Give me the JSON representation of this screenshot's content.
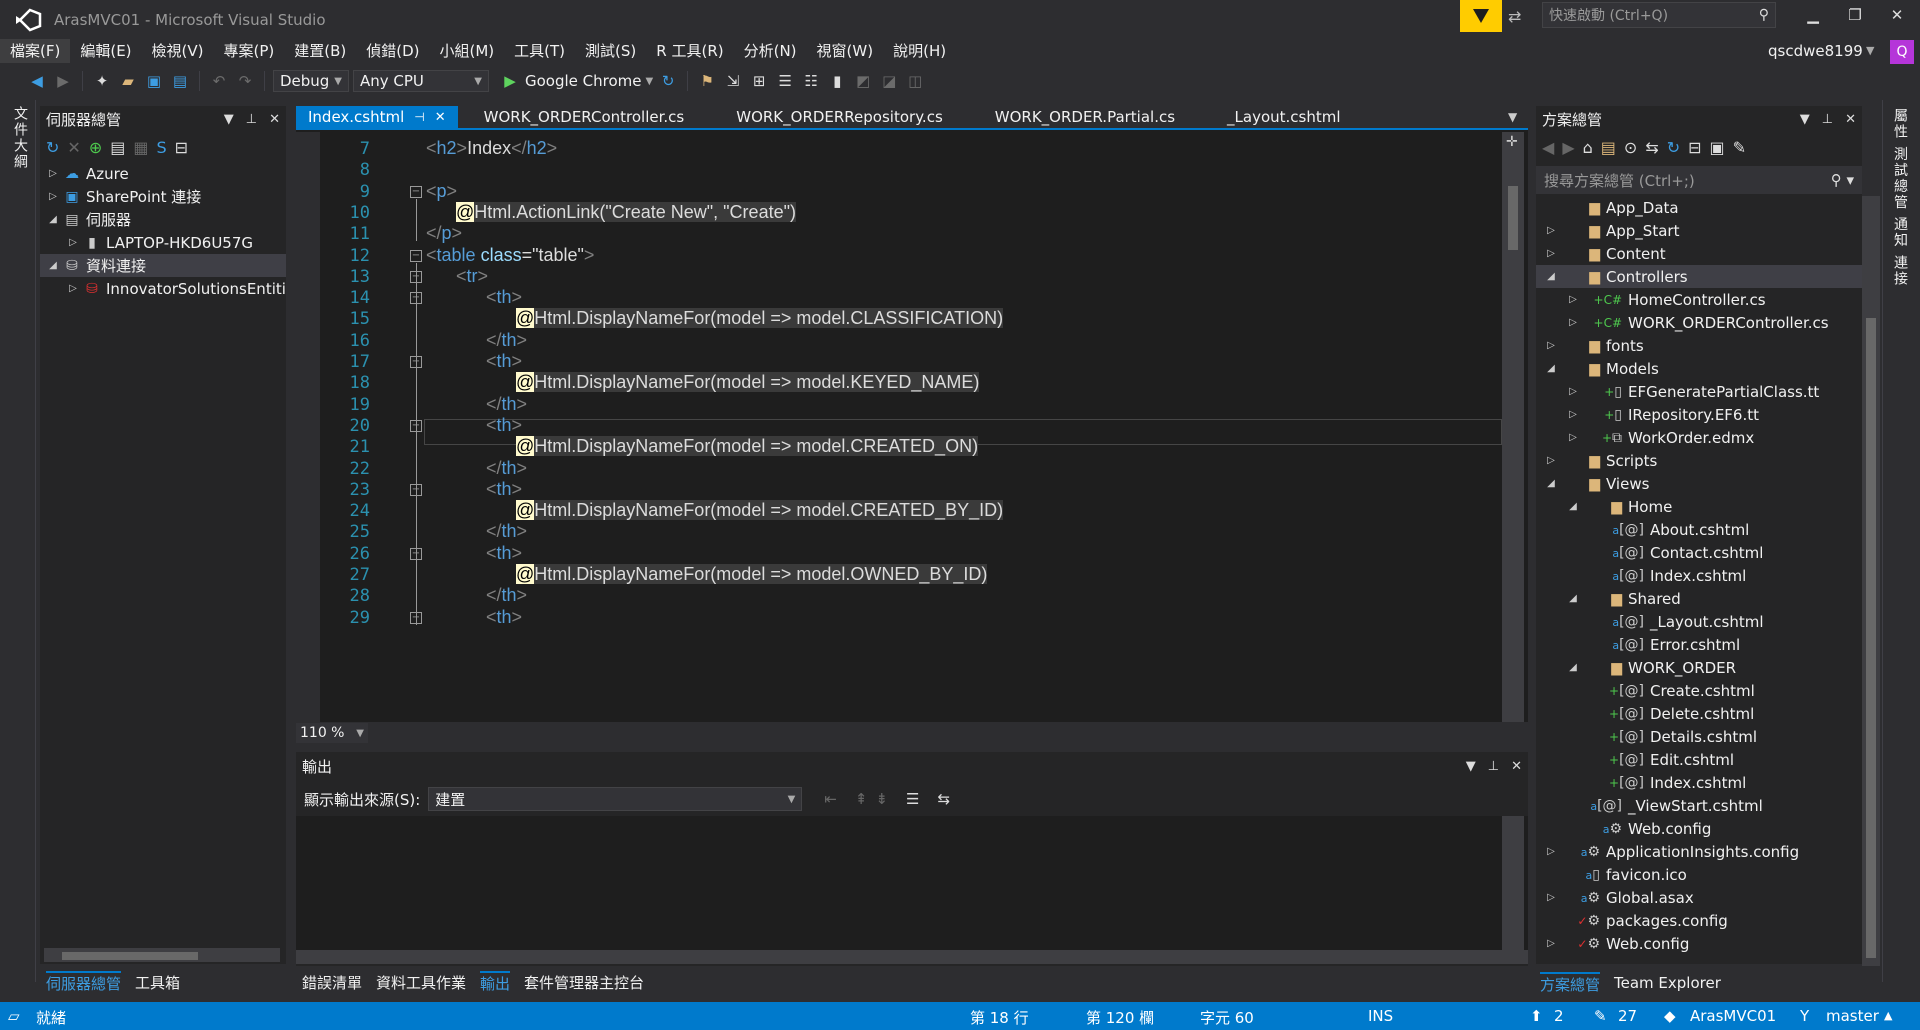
{
  "title": "ArasMVC01 - Microsoft Visual Studio",
  "quick_launch": {
    "placeholder": "快速啟動 (Ctrl+Q)"
  },
  "menu": [
    "檔案(F)",
    "編輯(E)",
    "檢視(V)",
    "專案(P)",
    "建置(B)",
    "偵錯(D)",
    "小組(M)",
    "工具(T)",
    "測試(S)",
    "R 工具(R)",
    "分析(N)",
    "視窗(W)",
    "說明(H)"
  ],
  "user": "qscdwe8199",
  "avatar_letter": "Q",
  "toolbar": {
    "config": "Debug",
    "platform": "Any CPU",
    "run_target": "Google Chrome"
  },
  "left_strip": "文件大綱",
  "server_explorer": {
    "title": "伺服器總管",
    "items": [
      {
        "label": "Azure",
        "indent": 0,
        "expander": "right",
        "icon": "cloud-icon"
      },
      {
        "label": "SharePoint 連接",
        "indent": 0,
        "expander": "right",
        "icon": "sharepoint-icon"
      },
      {
        "label": "伺服器",
        "indent": 0,
        "expander": "down",
        "icon": "server-icon"
      },
      {
        "label": "LAPTOP-HKD6U57G",
        "indent": 1,
        "expander": "right",
        "icon": "computer-icon"
      },
      {
        "label": "資料連接",
        "indent": 0,
        "expander": "down",
        "icon": "data-connection-icon",
        "selected": true
      },
      {
        "label": "InnovatorSolutionsEntities",
        "indent": 1,
        "expander": "right",
        "icon": "database-error-icon"
      }
    ],
    "bottom_tabs": [
      "伺服器總管",
      "工具箱"
    ]
  },
  "editor": {
    "tabs": [
      {
        "label": "Index.cshtml",
        "active": true
      },
      {
        "label": "WORK_ORDERController.cs"
      },
      {
        "label": "WORK_ORDERRepository.cs"
      },
      {
        "label": "WORK_ORDER.Partial.cs"
      },
      {
        "label": "_Layout.cshtml"
      }
    ],
    "zoom": "110 %",
    "lines": [
      {
        "n": "7",
        "indent": 0,
        "parts": [
          [
            "tag",
            "<"
          ],
          [
            "tname",
            "h2"
          ],
          [
            "tag",
            ">"
          ],
          [
            "txt",
            "Index"
          ],
          [
            "tag",
            "</"
          ],
          [
            "tname",
            "h2"
          ],
          [
            "tag",
            ">"
          ]
        ]
      },
      {
        "n": "8",
        "indent": 0,
        "parts": []
      },
      {
        "n": "9",
        "indent": 0,
        "fold": true,
        "parts": [
          [
            "tag",
            "<"
          ],
          [
            "tname",
            "p"
          ],
          [
            "tag",
            ">"
          ]
        ]
      },
      {
        "n": "10",
        "indent": 1,
        "parts": [
          [
            "razor",
            "@"
          ],
          [
            "rzcode",
            "Html.ActionLink("
          ],
          [
            "rzstr",
            "\"Create New\""
          ],
          [
            "rzcode",
            ", "
          ],
          [
            "rzstr",
            "\"Create\""
          ],
          [
            "rzcode",
            ")"
          ]
        ]
      },
      {
        "n": "11",
        "indent": 0,
        "parts": [
          [
            "tag",
            "</"
          ],
          [
            "tname",
            "p"
          ],
          [
            "tag",
            ">"
          ]
        ]
      },
      {
        "n": "12",
        "indent": 0,
        "fold": true,
        "parts": [
          [
            "tag",
            "<"
          ],
          [
            "tname",
            "table"
          ],
          [
            "txt",
            " "
          ],
          [
            "attr",
            "class"
          ],
          [
            "txt",
            "=\"table\""
          ],
          [
            "tag",
            ">"
          ]
        ]
      },
      {
        "n": "13",
        "indent": 1,
        "fold": true,
        "parts": [
          [
            "tag",
            "<"
          ],
          [
            "tname",
            "tr"
          ],
          [
            "tag",
            ">"
          ]
        ]
      },
      {
        "n": "14",
        "indent": 2,
        "fold": true,
        "parts": [
          [
            "tag",
            "<"
          ],
          [
            "tname",
            "th"
          ],
          [
            "tag",
            ">"
          ]
        ]
      },
      {
        "n": "15",
        "indent": 3,
        "parts": [
          [
            "razor",
            "@"
          ],
          [
            "rzcode",
            "Html.DisplayNameFor(model => model.CLASSIFICATION)"
          ]
        ]
      },
      {
        "n": "16",
        "indent": 2,
        "parts": [
          [
            "tag",
            "</"
          ],
          [
            "tname",
            "th"
          ],
          [
            "tag",
            ">"
          ]
        ]
      },
      {
        "n": "17",
        "indent": 2,
        "fold": true,
        "parts": [
          [
            "tag",
            "<"
          ],
          [
            "tname",
            "th"
          ],
          [
            "tag",
            ">"
          ]
        ]
      },
      {
        "n": "18",
        "indent": 3,
        "parts": [
          [
            "razor",
            "@"
          ],
          [
            "rzcode",
            "Html.DisplayNameFor(model => model.KEYED_NAME)"
          ]
        ]
      },
      {
        "n": "19",
        "indent": 2,
        "parts": [
          [
            "tag",
            "</"
          ],
          [
            "tname",
            "th"
          ],
          [
            "tag",
            ">"
          ]
        ]
      },
      {
        "n": "20",
        "indent": 2,
        "fold": true,
        "parts": [
          [
            "tag",
            "<"
          ],
          [
            "tname",
            "th"
          ],
          [
            "tag",
            ">"
          ]
        ]
      },
      {
        "n": "21",
        "indent": 3,
        "parts": [
          [
            "razor",
            "@"
          ],
          [
            "rzcode",
            "Html.DisplayNameFor(model => model.CREATED_ON)"
          ]
        ]
      },
      {
        "n": "22",
        "indent": 2,
        "parts": [
          [
            "tag",
            "</"
          ],
          [
            "tname",
            "th"
          ],
          [
            "tag",
            ">"
          ]
        ]
      },
      {
        "n": "23",
        "indent": 2,
        "fold": true,
        "parts": [
          [
            "tag",
            "<"
          ],
          [
            "tname",
            "th"
          ],
          [
            "tag",
            ">"
          ]
        ]
      },
      {
        "n": "24",
        "indent": 3,
        "parts": [
          [
            "razor",
            "@"
          ],
          [
            "rzcode",
            "Html.DisplayNameFor(model => model.CREATED_BY_ID)"
          ]
        ]
      },
      {
        "n": "25",
        "indent": 2,
        "parts": [
          [
            "tag",
            "</"
          ],
          [
            "tname",
            "th"
          ],
          [
            "tag",
            ">"
          ]
        ]
      },
      {
        "n": "26",
        "indent": 2,
        "fold": true,
        "parts": [
          [
            "tag",
            "<"
          ],
          [
            "tname",
            "th"
          ],
          [
            "tag",
            ">"
          ]
        ]
      },
      {
        "n": "27",
        "indent": 3,
        "parts": [
          [
            "razor",
            "@"
          ],
          [
            "rzcode",
            "Html.DisplayNameFor(model => model.OWNED_BY_ID)"
          ]
        ]
      },
      {
        "n": "28",
        "indent": 2,
        "parts": [
          [
            "tag",
            "</"
          ],
          [
            "tname",
            "th"
          ],
          [
            "tag",
            ">"
          ]
        ]
      },
      {
        "n": "29",
        "indent": 2,
        "fold": true,
        "parts": [
          [
            "tag",
            "<"
          ],
          [
            "tname",
            "th"
          ],
          [
            "tag",
            ">"
          ]
        ]
      }
    ]
  },
  "output": {
    "title": "輸出",
    "source_label": "顯示輸出來源(S):",
    "source_value": "建置",
    "bottom_tabs": [
      "錯誤清單",
      "資料工具作業",
      "輸出",
      "套件管理器主控台"
    ]
  },
  "solution_explorer": {
    "title": "方案總管",
    "search_placeholder": "搜尋方案總管 (Ctrl+;)",
    "items": [
      {
        "label": "App_Data",
        "indent": 1,
        "expander": "",
        "icon": "folder"
      },
      {
        "label": "App_Start",
        "indent": 1,
        "expander": "right",
        "icon": "folder"
      },
      {
        "label": "Content",
        "indent": 1,
        "expander": "right",
        "icon": "folder"
      },
      {
        "label": "Controllers",
        "indent": 1,
        "expander": "down",
        "icon": "folder",
        "selected": true
      },
      {
        "label": "HomeController.cs",
        "indent": 2,
        "expander": "right",
        "icon": "cs"
      },
      {
        "label": "WORK_ORDERController.cs",
        "indent": 2,
        "expander": "right",
        "icon": "cs"
      },
      {
        "label": "fonts",
        "indent": 1,
        "expander": "right",
        "icon": "folder"
      },
      {
        "label": "Models",
        "indent": 1,
        "expander": "down",
        "icon": "folder"
      },
      {
        "label": "EFGeneratePartialClass.tt",
        "indent": 2,
        "expander": "right",
        "icon": "file-plus"
      },
      {
        "label": "IRepository.EF6.tt",
        "indent": 2,
        "expander": "right",
        "icon": "file-plus"
      },
      {
        "label": "WorkOrder.edmx",
        "indent": 2,
        "expander": "right",
        "icon": "edmx"
      },
      {
        "label": "Scripts",
        "indent": 1,
        "expander": "right",
        "icon": "folder"
      },
      {
        "label": "Views",
        "indent": 1,
        "expander": "down",
        "icon": "folder"
      },
      {
        "label": "Home",
        "indent": 2,
        "expander": "down",
        "icon": "folder"
      },
      {
        "label": "About.cshtml",
        "indent": 3,
        "expander": "",
        "icon": "razor-lock"
      },
      {
        "label": "Contact.cshtml",
        "indent": 3,
        "expander": "",
        "icon": "razor-lock"
      },
      {
        "label": "Index.cshtml",
        "indent": 3,
        "expander": "",
        "icon": "razor-lock"
      },
      {
        "label": "Shared",
        "indent": 2,
        "expander": "down",
        "icon": "folder"
      },
      {
        "label": "_Layout.cshtml",
        "indent": 3,
        "expander": "",
        "icon": "razor-lock"
      },
      {
        "label": "Error.cshtml",
        "indent": 3,
        "expander": "",
        "icon": "razor-lock"
      },
      {
        "label": "WORK_ORDER",
        "indent": 2,
        "expander": "down",
        "icon": "folder"
      },
      {
        "label": "Create.cshtml",
        "indent": 3,
        "expander": "",
        "icon": "razor-plus"
      },
      {
        "label": "Delete.cshtml",
        "indent": 3,
        "expander": "",
        "icon": "razor-plus"
      },
      {
        "label": "Details.cshtml",
        "indent": 3,
        "expander": "",
        "icon": "razor-plus"
      },
      {
        "label": "Edit.cshtml",
        "indent": 3,
        "expander": "",
        "icon": "razor-plus"
      },
      {
        "label": "Index.cshtml",
        "indent": 3,
        "expander": "",
        "icon": "razor-plus"
      },
      {
        "label": "_ViewStart.cshtml",
        "indent": 2,
        "expander": "",
        "icon": "razor-lock"
      },
      {
        "label": "Web.config",
        "indent": 2,
        "expander": "",
        "icon": "config-lock"
      },
      {
        "label": "ApplicationInsights.config",
        "indent": 1,
        "expander": "right",
        "icon": "config-lock"
      },
      {
        "label": "favicon.ico",
        "indent": 1,
        "expander": "",
        "icon": "file-lock"
      },
      {
        "label": "Global.asax",
        "indent": 1,
        "expander": "right",
        "icon": "config-lock"
      },
      {
        "label": "packages.config",
        "indent": 1,
        "expander": "",
        "icon": "config-check"
      },
      {
        "label": "Web.config",
        "indent": 1,
        "expander": "right",
        "icon": "config-check"
      }
    ],
    "bottom_tabs": [
      "方案總管",
      "Team Explorer"
    ]
  },
  "right_strip": "屬性 測試總管 通知 連接",
  "status": {
    "ready": "就緒",
    "line": "第 18 行",
    "col": "第 120 欄",
    "ch": "字元 60",
    "ins": "INS",
    "up": "2",
    "edits": "27",
    "repo": "ArasMVC01",
    "branch": "master"
  }
}
